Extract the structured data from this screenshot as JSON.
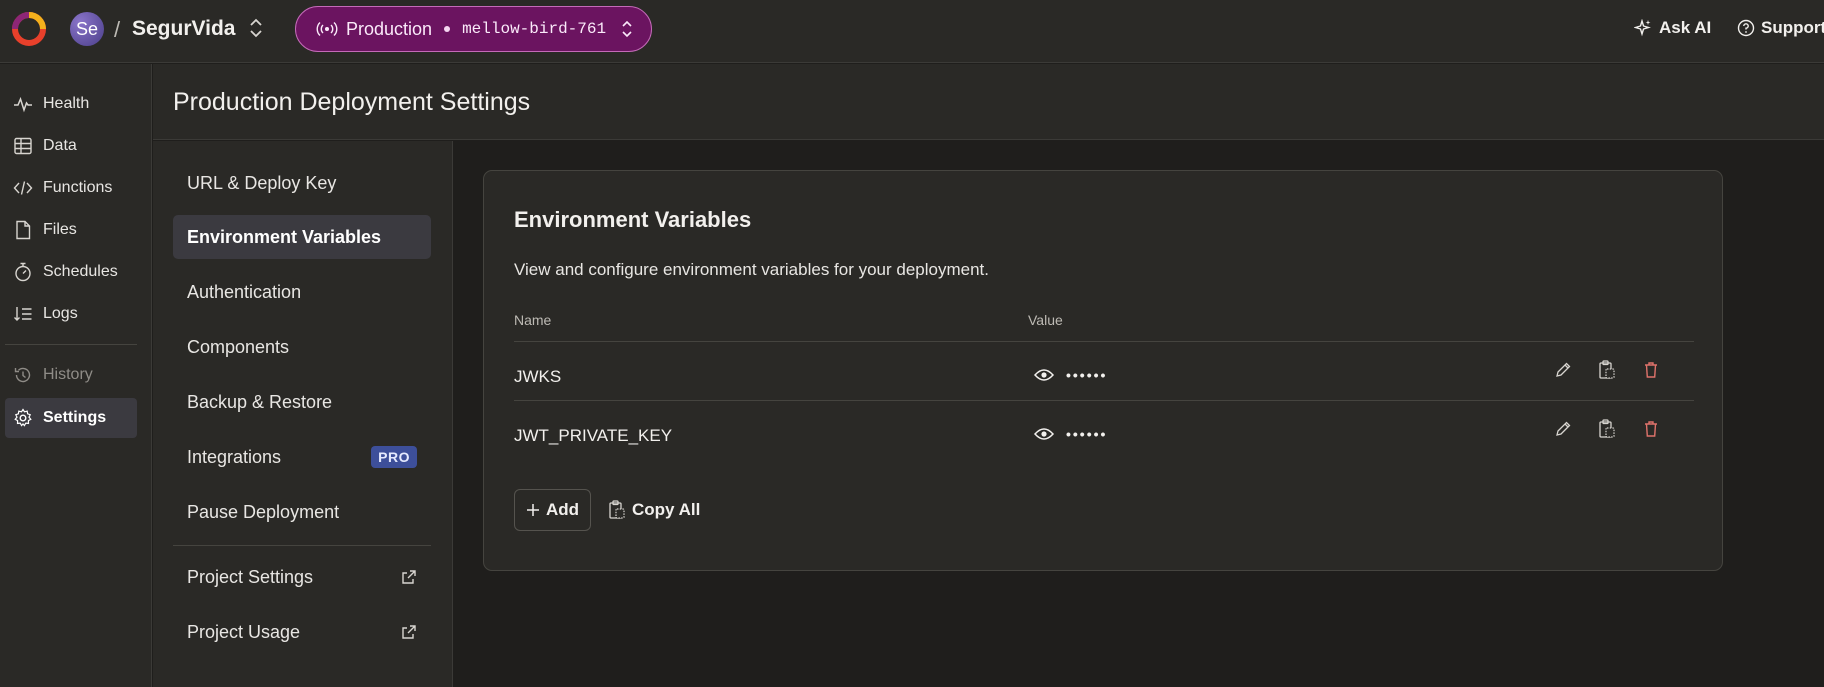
{
  "topbar": {
    "avatar_initials": "Se",
    "separator": "/",
    "project_name": "SegurVida",
    "environment": {
      "label": "Production",
      "deployment_name": "mellow-bird-761",
      "accent_color": "#6b1460"
    },
    "ask_ai_label": "Ask AI",
    "support_label": "Support"
  },
  "rail": {
    "items": [
      {
        "label": "Health",
        "icon": "health-pulse-icon"
      },
      {
        "label": "Data",
        "icon": "table-icon"
      },
      {
        "label": "Functions",
        "icon": "code-icon"
      },
      {
        "label": "Files",
        "icon": "file-icon"
      },
      {
        "label": "Schedules",
        "icon": "stopwatch-icon"
      },
      {
        "label": "Logs",
        "icon": "logs-icon"
      },
      {
        "label": "History",
        "icon": "history-icon"
      },
      {
        "label": "Settings",
        "icon": "gear-icon"
      }
    ],
    "active": "Settings"
  },
  "header": {
    "title": "Production Deployment Settings"
  },
  "subnav": {
    "items": [
      {
        "label": "URL & Deploy Key"
      },
      {
        "label": "Environment Variables"
      },
      {
        "label": "Authentication"
      },
      {
        "label": "Components"
      },
      {
        "label": "Backup & Restore"
      },
      {
        "label": "Integrations",
        "badge": "PRO"
      },
      {
        "label": "Pause Deployment"
      },
      {
        "label": "Project Settings",
        "icon": "external-link-icon"
      },
      {
        "label": "Project Usage",
        "icon": "external-link-icon"
      }
    ],
    "active": "Environment Variables"
  },
  "card": {
    "title": "Environment Variables",
    "description": "View and configure environment variables for your deployment.",
    "columns": {
      "name": "Name",
      "value": "Value"
    },
    "variables": [
      {
        "name": "JWKS",
        "masked_value": "••••••"
      },
      {
        "name": "JWT_PRIVATE_KEY",
        "masked_value": "••••••"
      }
    ],
    "add_label": "Add",
    "copy_all_label": "Copy All"
  },
  "colors": {
    "background": "#1f1e1c",
    "panel": "#2a2926",
    "active_item": "#3b3a40",
    "pro_badge": "#3d4f9a",
    "delete_icon": "#e0736b"
  }
}
